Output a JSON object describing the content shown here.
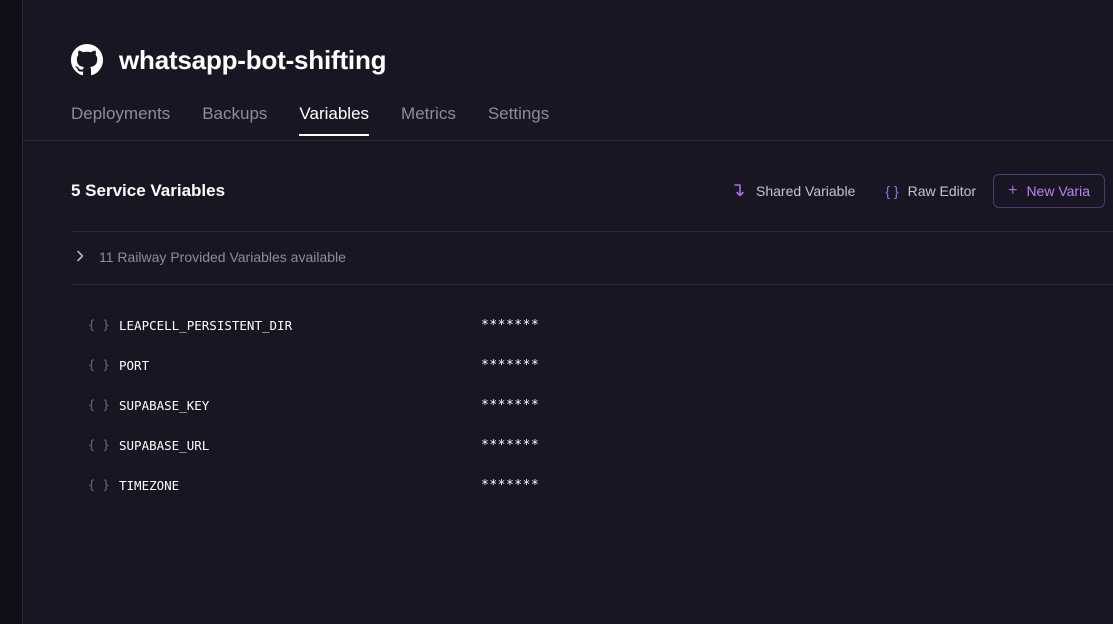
{
  "service": {
    "title": "whatsapp-bot-shifting",
    "icon": "github-icon"
  },
  "tabs": [
    {
      "label": "Deployments",
      "active": false
    },
    {
      "label": "Backups",
      "active": false
    },
    {
      "label": "Variables",
      "active": true
    },
    {
      "label": "Metrics",
      "active": false
    },
    {
      "label": "Settings",
      "active": false
    }
  ],
  "variables_section": {
    "title": "5 Service Variables",
    "shared_variable_label": "Shared Variable",
    "raw_editor_label": "Raw Editor",
    "new_variable_label": "New Varia",
    "provided_label": "11 Railway Provided Variables available"
  },
  "variables": [
    {
      "name": "LEAPCELL_PERSISTENT_DIR",
      "value": "*******"
    },
    {
      "name": "PORT",
      "value": "*******"
    },
    {
      "name": "SUPABASE_KEY",
      "value": "*******"
    },
    {
      "name": "SUPABASE_URL",
      "value": "*******"
    },
    {
      "name": "TIMEZONE",
      "value": "*******"
    }
  ],
  "colors": {
    "accent": "#a86ce8",
    "background": "#181622",
    "text": "#ffffff",
    "muted": "#8e8b9c"
  }
}
